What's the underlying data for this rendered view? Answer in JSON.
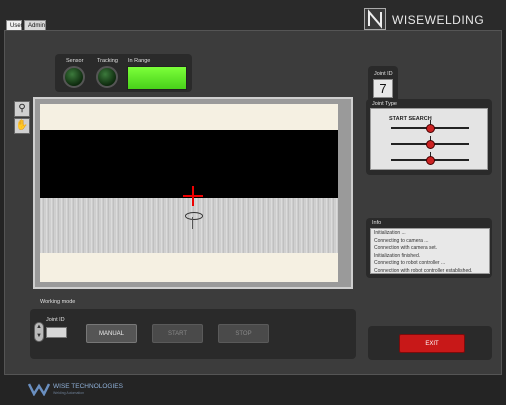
{
  "tabs": [
    {
      "label": "User",
      "active": true
    },
    {
      "label": "Admin",
      "active": false
    }
  ],
  "brand": {
    "logo_text": "WISEWELDING",
    "footer_text": "WISE TECHNOLOGIES",
    "footer_sub": "Welding Automation"
  },
  "status": {
    "sensor_label": "Sensor",
    "tracking_label": "Tracking",
    "inrange_label": "In Range",
    "inrange_color": "#5ee82a"
  },
  "viewer": {
    "zoom_icon": "magnifier-icon",
    "pan_icon": "hand-icon"
  },
  "joint": {
    "id_label": "Joint ID",
    "id_value": "7",
    "type_label": "Joint Type",
    "type_value": "START SEARCH"
  },
  "info": {
    "label": "Info",
    "lines": [
      "Initialization ...",
      "Connecting to camera ...",
      "Connection with camera set.",
      "Initialization finished.",
      "Connecting to robot controller ...",
      "Connection with robot controller established."
    ]
  },
  "working_mode": {
    "label": "Working mode",
    "joint_id_label": "Joint ID",
    "joint_id_value": "",
    "buttons": {
      "manual": "MANUAL",
      "start": "START",
      "stop": "STOP"
    }
  },
  "exit_label": "EXIT"
}
